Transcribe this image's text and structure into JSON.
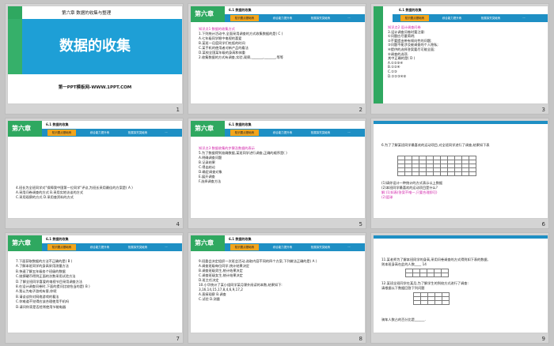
{
  "header": {
    "chapter": "第六章",
    "section": "6.1 数据的收集",
    "tabs": [
      "知识要点基础练",
      "综合能力提升练",
      "拓展探究突破练",
      "···"
    ]
  },
  "slides": [
    {
      "num": "1",
      "chapter_line": "第六章    数据的收集与整理",
      "title": "数据的收集",
      "subtitle": "第一PPT模板网-WWW.1PPT.COM"
    },
    {
      "num": "2",
      "lines": [
        {
          "t": "知识点1  数据的收集方式",
          "c": "accent"
        },
        {
          "t": "1.下列统计活动中,全面采用调查的方式收集数据的是(  C  )",
          "c": ""
        },
        {
          "t": "A.七年级同学眼中电视的喜爱",
          "c": ""
        },
        {
          "t": "B.某班一月度同学们吃饭的时间",
          "c": ""
        },
        {
          "t": "C.某手机的使用者对新产品的看法",
          "c": ""
        },
        {
          "t": "D.某校全国某年级的身高和体重",
          "c": ""
        },
        {
          "t": "2.收集数据的方式有调查,实验,观察,_______,_______,等等",
          "c": ""
        }
      ]
    },
    {
      "num": "3",
      "lines": [
        {
          "t": "知识点2  设计调查问卷",
          "c": "accent"
        },
        {
          "t": "3.设计调查问卷时要注意:",
          "c": ""
        },
        {
          "t": "①问题应尽量简明;",
          "c": ""
        },
        {
          "t": "②不要提出带有倾向性的问题;",
          "c": ""
        },
        {
          "t": "③问题不能涉及被调查的个人隐私;",
          "c": ""
        },
        {
          "t": "④提供的选择答案要尽可能全面;",
          "c": ""
        },
        {
          "t": "⑤调查的选项.",
          "c": ""
        },
        {
          "t": "其中正确的是(  D  )",
          "c": ""
        },
        {
          "t": "A.①②③④",
          "c": ""
        },
        {
          "t": "B.①②④",
          "c": ""
        },
        {
          "t": "C.①③",
          "c": ""
        },
        {
          "t": "D.①②③④⑤",
          "c": ""
        }
      ]
    },
    {
      "num": "4",
      "lines": [
        {
          "t": "4.班长为全班同学对\"保障我中国第一位同学\"评议,为班长采用最佳的方案是(  A  )",
          "c": ""
        },
        {
          "t": "A.采用问卷调查的方式    B.采用实地访谈的方式",
          "c": ""
        },
        {
          "t": "C.采用观察的方式    D.采用查资料的方式",
          "c": ""
        }
      ]
    },
    {
      "num": "5",
      "lines": [
        {
          "t": "知识点3  数据收集的步骤及数据的表示",
          "c": "accent"
        },
        {
          "t": "5.为了数据得到准确数据,某班同学进行调查,正确的顺序是(  )",
          "c": ""
        },
        {
          "t": "A.明确调查问题",
          "c": ""
        },
        {
          "t": "B.记录结果",
          "c": ""
        },
        {
          "t": "C.得出结论",
          "c": ""
        },
        {
          "t": "D.确定调查对象",
          "c": ""
        },
        {
          "t": "E.展开调查",
          "c": ""
        },
        {
          "t": "F.选择调查方法",
          "c": ""
        }
      ]
    },
    {
      "num": "6",
      "lines": [
        {
          "t": "6.为了了解某班同学最喜欢的运动项目,对全班同学进行了调查,结果如下表",
          "c": ""
        },
        {
          "t": "(1)请你设计一种统计的方式表示以上数据",
          "c": ""
        },
        {
          "t": "(2)本班同学最喜欢的运动项目是什么?",
          "c": ""
        },
        {
          "t": "解:(1)如表(答案不唯一,只要合理即可)",
          "c": "accent"
        },
        {
          "t": "(2)篮球",
          "c": "accent"
        }
      ]
    },
    {
      "num": "7",
      "lines": [
        {
          "t": "7.下面获取数据的方法不正确的是(  B  )",
          "c": ""
        },
        {
          "t": "A.了解本班同学的身高采用测量方法",
          "c": ""
        },
        {
          "t": "B.快速了解五年级各个班级的数据",
          "c": ""
        },
        {
          "t": "C.抛掷硬币得到正面的次数采用试验方法",
          "c": ""
        },
        {
          "t": "D.了解全班同学喜爱的电视节目采用调查方法",
          "c": ""
        },
        {
          "t": "8.在设计调查问卷时,下面的提问比较恰当的是(  B  )",
          "c": ""
        },
        {
          "t": "A.我认为电子游戏有害,你呢",
          "c": ""
        },
        {
          "t": "B.请谈谈你对网络游戏的看法",
          "c": ""
        },
        {
          "t": "C.你难道不觉得应该合理使用手机吗",
          "c": ""
        },
        {
          "t": "D.请问你家是否经常使用节能电器",
          "c": ""
        }
      ]
    },
    {
      "num": "8",
      "lines": [
        {
          "t": "9.班委会决定组织一次班会活动,选取内容不同的四个方案,下列做法正确的是(  A  )",
          "c": ""
        },
        {
          "t": "A.调查班级每位同学,统计结果决定",
          "c": ""
        },
        {
          "t": "B.调查班级男生,统计结果决定",
          "c": ""
        },
        {
          "t": "C.调查班级女生,统计结果决定",
          "c": ""
        },
        {
          "t": "D.班主任决定",
          "c": ""
        },
        {
          "t": "10.小华统计了某小组同学某月课外阅读的本数,结果如下:",
          "c": ""
        },
        {
          "t": "3,16,14,15,17,8,4,6,9,17,2",
          "c": ""
        },
        {
          "t": "A.直接观察    B.调查",
          "c": ""
        },
        {
          "t": "C.试验    D.测量",
          "c": ""
        }
      ]
    },
    {
      "num": "9",
      "lines": [
        {
          "t": "11.某老师为了解本班同学的身高,采用问卷调查的方式得到如下表的数据,",
          "c": ""
        },
        {
          "t": "则本班身高在此的人数____  14",
          "c": ""
        },
        {
          "t": "12.某班全班同学在某月,为了解学生的到校方式进行了调查:",
          "c": ""
        },
        {
          "t": "请根据以下数据回答下列问题",
          "c": ""
        },
        {
          "t": "骑车人数占的百分比是______.",
          "c": ""
        }
      ]
    }
  ]
}
